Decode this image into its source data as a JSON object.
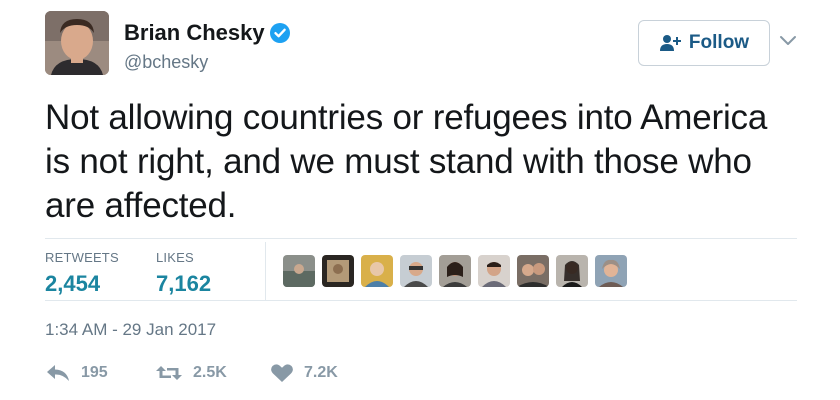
{
  "author": {
    "display_name": "Brian Chesky",
    "handle": "@bchesky",
    "verified_icon": "verified-badge-icon",
    "avatar_icon": "profile-photo"
  },
  "follow_button": {
    "label": "Follow",
    "icon": "add-user-icon"
  },
  "menu_caret_icon": "chevron-down-icon",
  "tweet": {
    "line1": "Not allowing countries or refugees into America",
    "line2": "is not right, and we must stand with those who",
    "line3": "are affected."
  },
  "stats": {
    "retweets_label": "RETWEETS",
    "retweets_value": "2,454",
    "likes_label": "LIKES",
    "likes_value": "7,162"
  },
  "timestamp": "1:34 AM - 29 Jan 2017",
  "actions": {
    "reply_count": "195",
    "retweet_count": "2.5K",
    "like_count": "7.2K"
  },
  "colors": {
    "accent": "#1b85a0",
    "follow_text": "#1b5a86",
    "muted": "#657786",
    "verified": "#1da1f2",
    "action_icon": "#8899a6"
  }
}
